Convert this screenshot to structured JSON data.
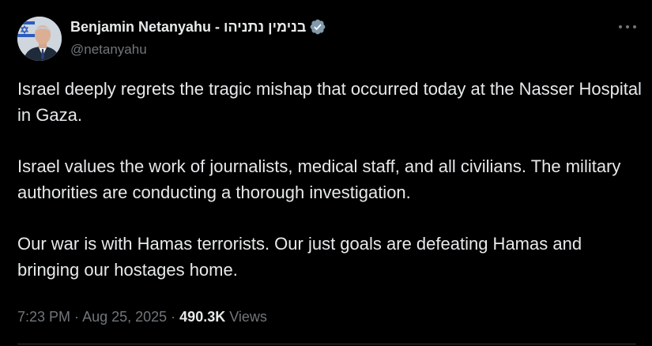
{
  "author": {
    "display_name": "Benjamin Netanyahu - בנימין נתניהו",
    "handle": "@netanyahu",
    "verified_icon": "verified-badge-icon",
    "avatar_icon": "profile-avatar"
  },
  "menu_icon": "more-options-icon",
  "post": {
    "paragraphs": [
      "Israel deeply regrets the tragic mishap that occurred today at the Nasser Hospital in Gaza.",
      "Israel values the work of journalists, medical staff, and all civilians. The military authorities are conducting a thorough investigation.",
      "Our war is with Hamas terrorists. Our just goals are defeating Hamas and bringing our hostages home."
    ]
  },
  "meta": {
    "time": "7:23 PM",
    "separator": " · ",
    "date": "Aug 25, 2025",
    "views_count": "490.3K",
    "views_label": "Views"
  },
  "colors": {
    "background": "#000000",
    "text": "#e7e9ea",
    "secondary": "#71767b",
    "verified": "#829aab"
  }
}
